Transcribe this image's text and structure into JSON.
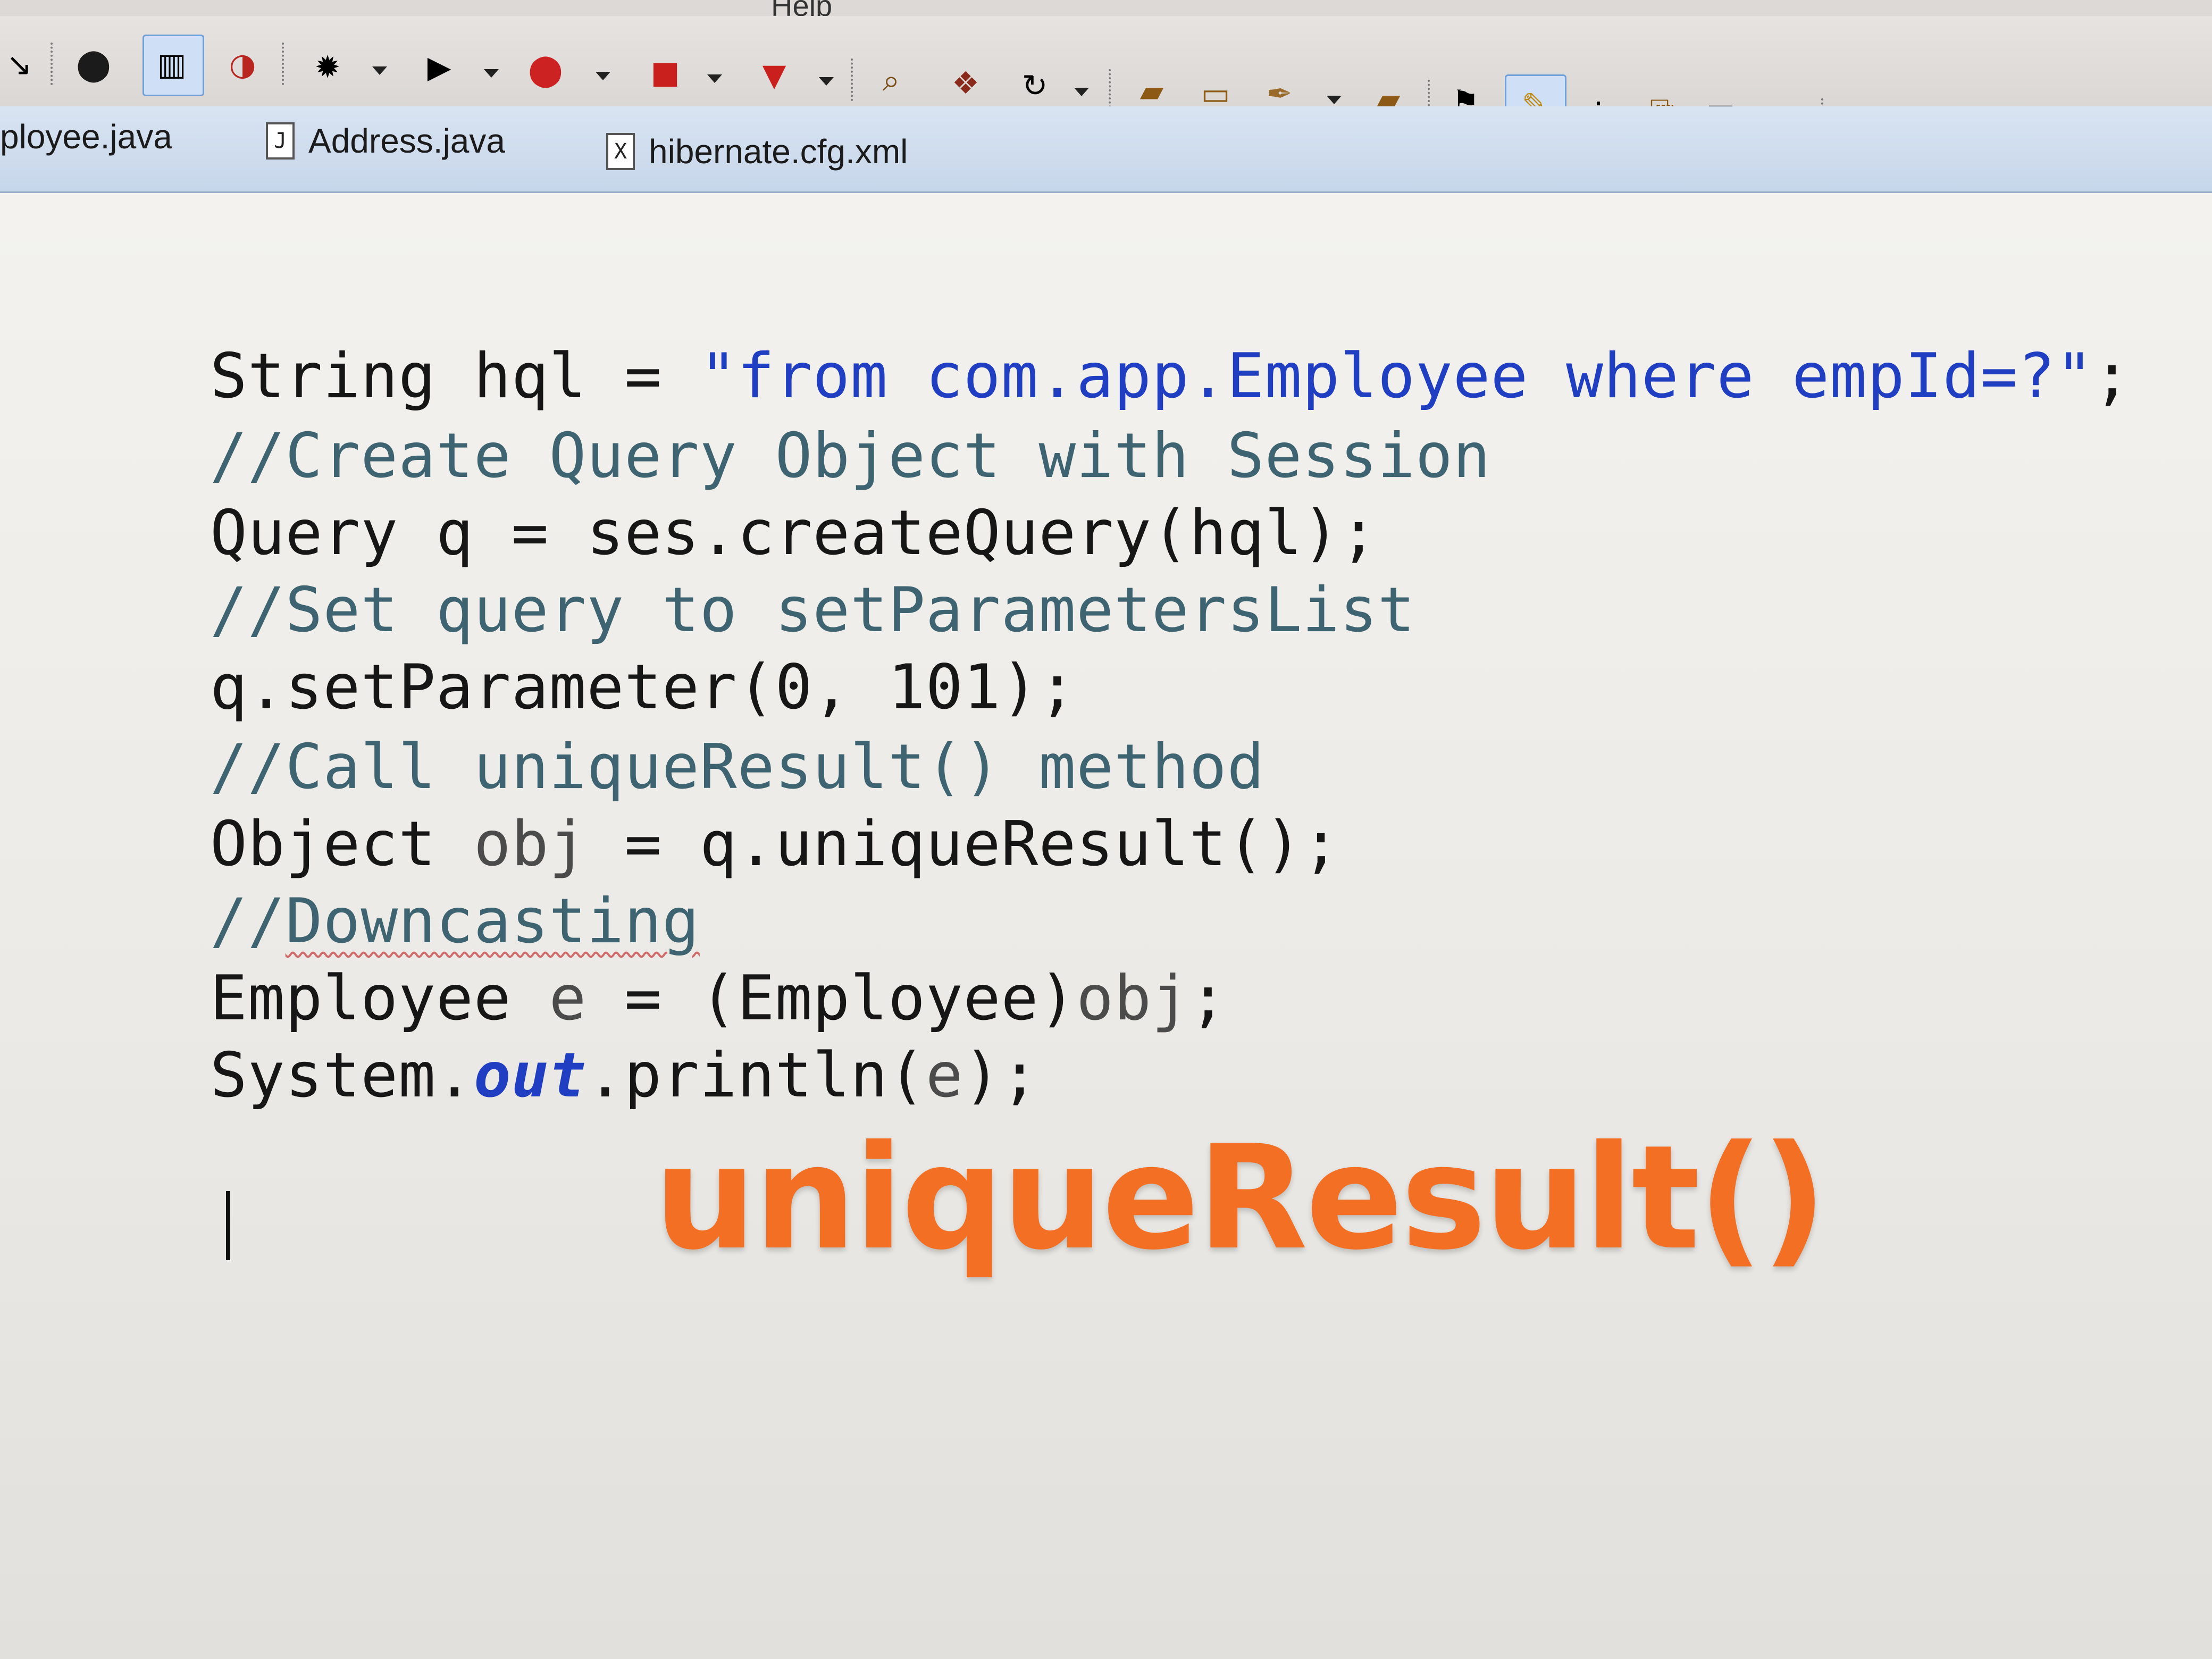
{
  "menu": {
    "help_label": "Help"
  },
  "toolbar": {
    "icons": [
      "arrow-icon",
      "debug-icon",
      "layout-icon",
      "perspective-icon",
      "bug-icon",
      "run-icon",
      "run-external-icon",
      "stop-icon",
      "step-icon",
      "search-icon",
      "package-icon",
      "refresh-icon",
      "open-folder-icon",
      "folder-icon",
      "tool-icon",
      "open-icon",
      "pin-icon",
      "highlight-icon",
      "share-icon",
      "copy-icon",
      "document-icon",
      "text-icon",
      "next-annotation-icon",
      "prev-annotation-icon",
      "back-icon",
      "forward-icon"
    ]
  },
  "tabs": [
    {
      "label": "ployee.java",
      "icon": ""
    },
    {
      "label": "Address.java",
      "icon": "J"
    },
    {
      "label": "hibernate.cfg.xml",
      "icon": "X"
    }
  ],
  "code": {
    "l1_kw": "String hql = ",
    "l1_str": "\"from com.app.Employee where empId=?\"",
    "l1_end": ";",
    "l2": "//Create Query Object with Session",
    "l3": "Query q = ses.createQuery(hql);",
    "l4": "//Set query to setParametersList",
    "l5": "q.setParameter(0, 101);",
    "l6": "//Call uniqueResult() method",
    "l7_a": "Object ",
    "l7_var": "obj",
    "l7_b": " = q.uniqueResult();",
    "l8_a": "//",
    "l8_squig": "Downcasting",
    "l9_a": "Employee ",
    "l9_var": "e",
    "l9_b": " = (Employee)",
    "l9_var2": "obj",
    "l9_c": ";",
    "l10_a": "System.",
    "l10_field": "out",
    "l10_b": ".println(",
    "l10_var": "e",
    "l10_c": ");"
  },
  "overlay_title": "uniqueResult()",
  "colors": {
    "string": "#1f3ec2",
    "comment": "#3d6470",
    "overlay": "#f36f23",
    "tab_bar": "#c6d6ea"
  }
}
